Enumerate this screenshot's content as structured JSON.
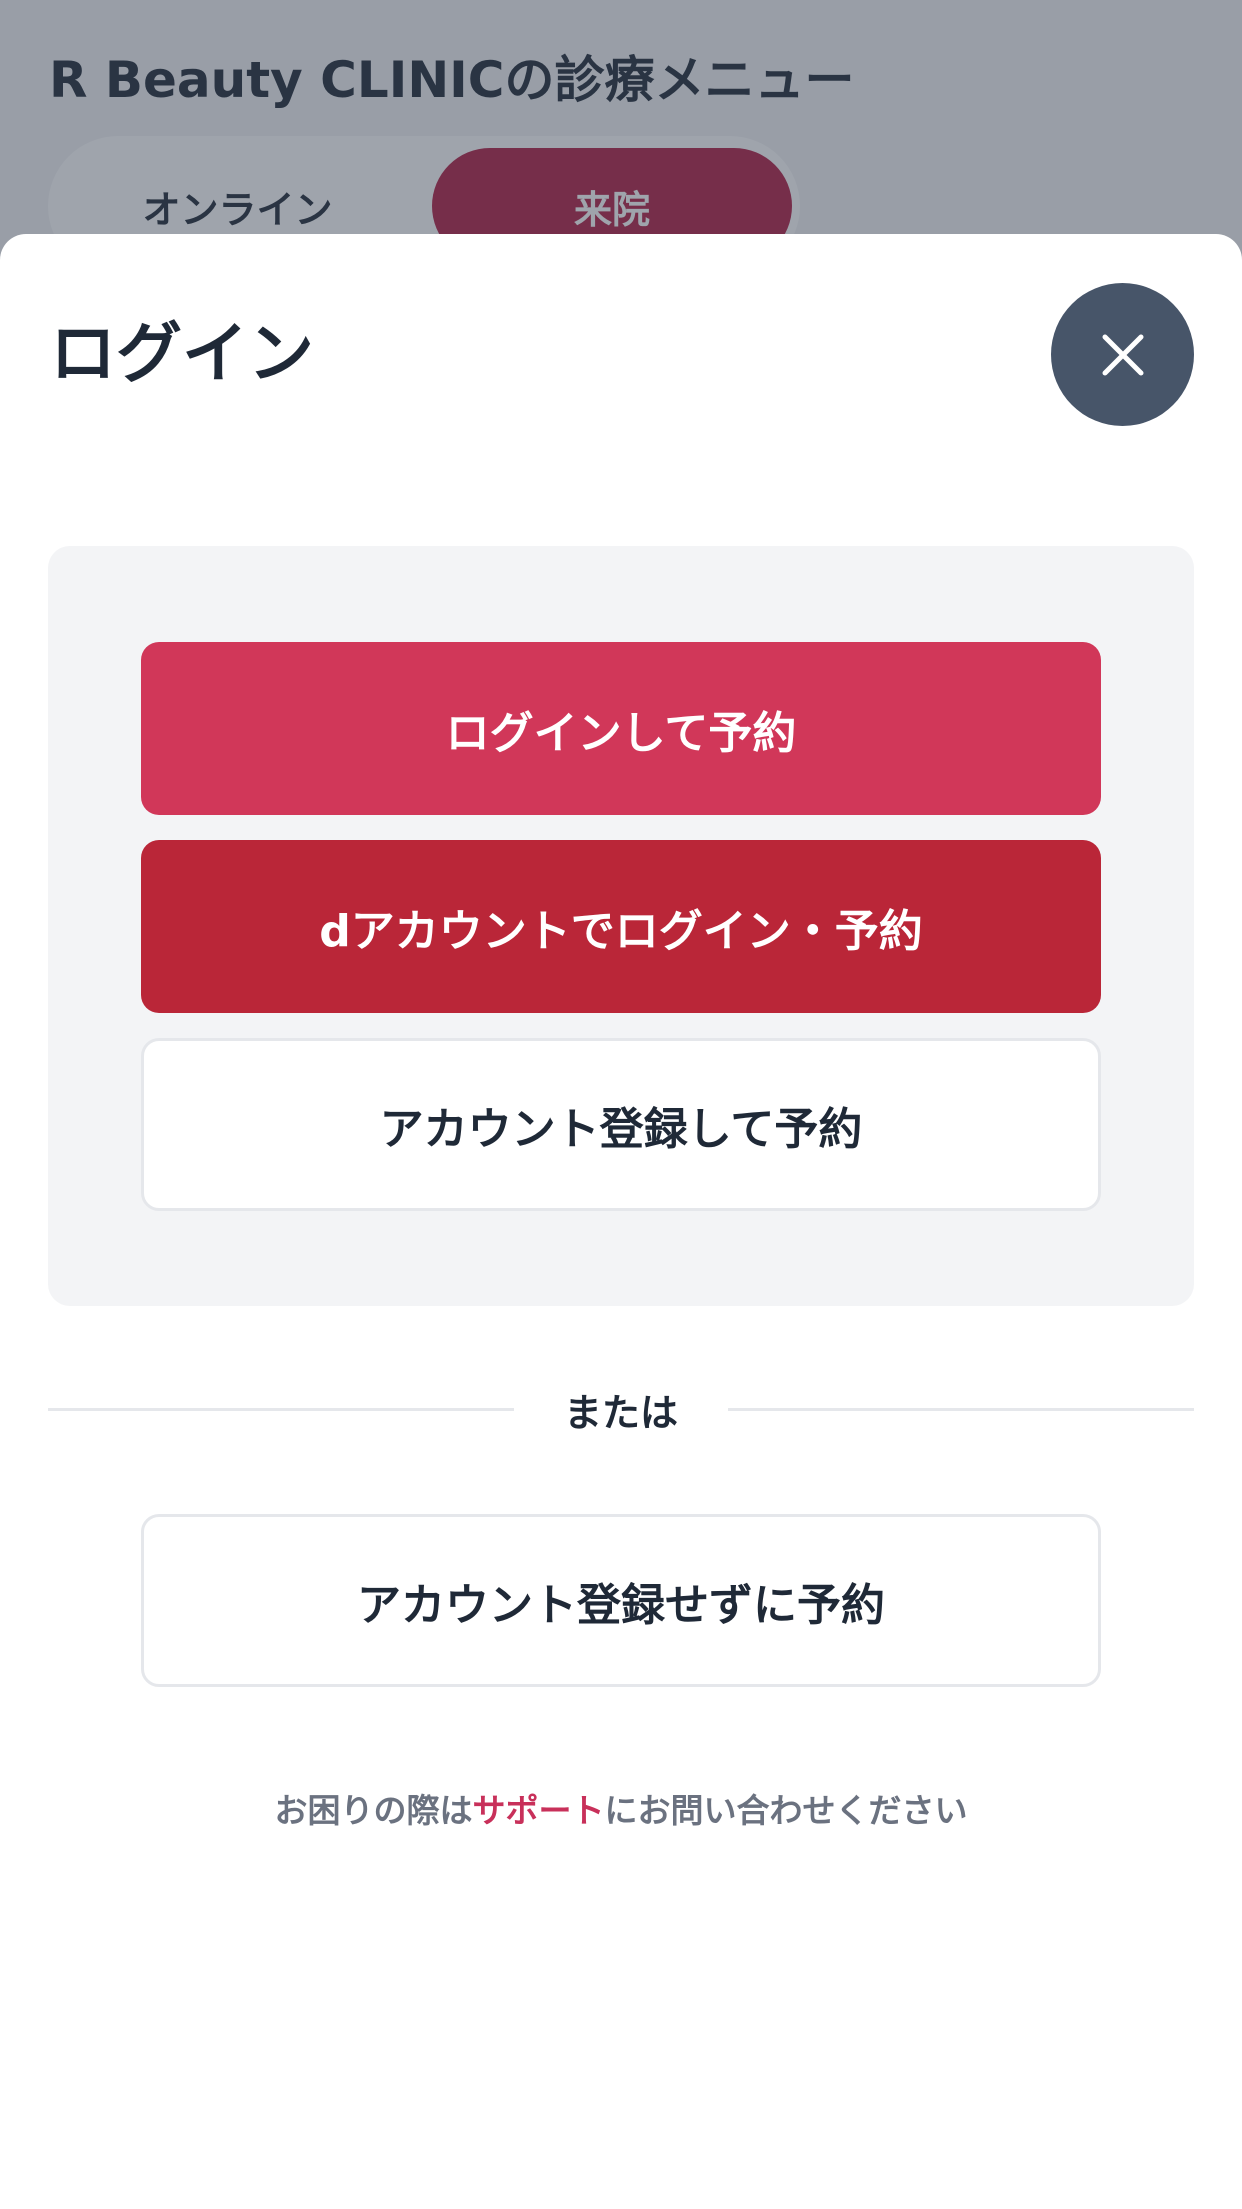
{
  "background": {
    "title": "R Beauty CLINICの診療メニュー",
    "segments": {
      "online": "オンライン",
      "visit": "来院"
    }
  },
  "modal": {
    "title": "ログイン",
    "close_icon": "close-icon",
    "buttons": {
      "login": "ログインして予約",
      "d_account": "dアカウントでログイン・予約",
      "register": "アカウント登録して予約",
      "guest": "アカウント登録せずに予約"
    },
    "divider_text": "または",
    "help": {
      "before": "お困りの際は",
      "link": "サポート",
      "after": "にお問い合わせください"
    }
  },
  "colors": {
    "primary": "#d13759",
    "d_account": "#ba2638",
    "accent_segment": "#b01e44",
    "link": "#c8305a",
    "close_button": "#475569"
  }
}
